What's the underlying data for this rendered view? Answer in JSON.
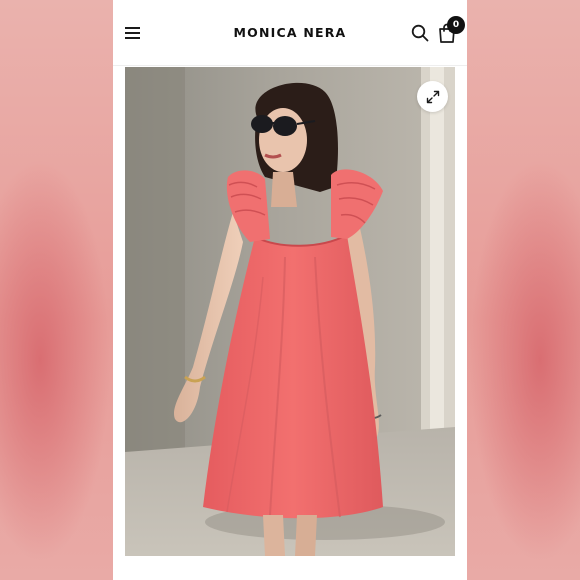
{
  "header": {
    "brand": "MONICA NERA",
    "cart_count": "0"
  },
  "icons": {
    "menu": "hamburger-menu-icon",
    "search": "search-icon",
    "cart": "shopping-bag-icon",
    "expand": "expand-icon"
  },
  "product": {
    "image": "woman-in-coral-ruffle-dress",
    "dress_color": "#f2706f"
  }
}
